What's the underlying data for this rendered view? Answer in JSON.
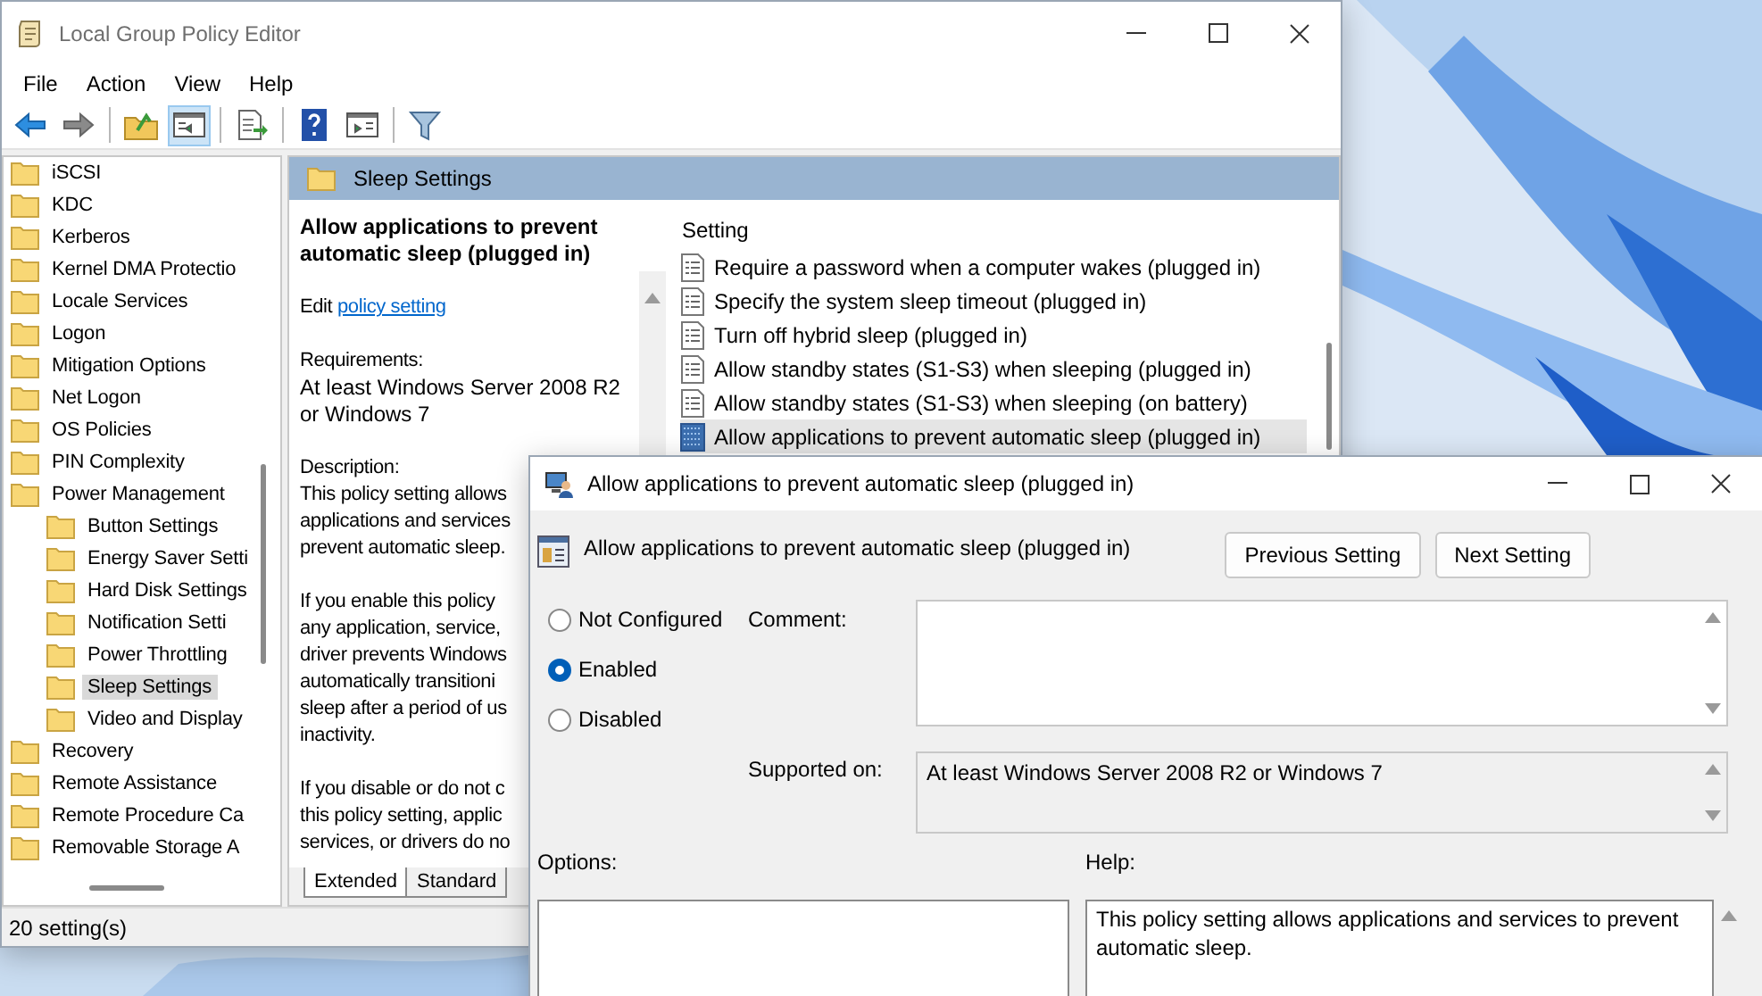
{
  "main_window": {
    "title": "Local Group Policy Editor",
    "menu": [
      "File",
      "Action",
      "View",
      "Help"
    ],
    "toolbar": [
      {
        "kind": "back",
        "pressed": false
      },
      {
        "kind": "forward",
        "pressed": false
      },
      {
        "kind": "separator"
      },
      {
        "kind": "up",
        "pressed": false
      },
      {
        "kind": "tree",
        "pressed": true
      },
      {
        "kind": "separator"
      },
      {
        "kind": "export",
        "pressed": false
      },
      {
        "kind": "separator"
      },
      {
        "kind": "help",
        "pressed": false
      },
      {
        "kind": "pane",
        "pressed": false
      },
      {
        "kind": "separator"
      },
      {
        "kind": "filter",
        "pressed": false
      }
    ],
    "tree": [
      {
        "label": "iSCSI",
        "selected": false
      },
      {
        "label": "KDC",
        "selected": false
      },
      {
        "label": "Kerberos",
        "selected": false
      },
      {
        "label": "Kernel DMA Protectio",
        "selected": false
      },
      {
        "label": "Locale Services",
        "selected": false
      },
      {
        "label": "Logon",
        "selected": false
      },
      {
        "label": "Mitigation Options",
        "selected": false
      },
      {
        "label": "Net Logon",
        "selected": false
      },
      {
        "label": "OS Policies",
        "selected": false
      },
      {
        "label": "PIN Complexity",
        "selected": false
      },
      {
        "label": "Power Management",
        "selected": false,
        "children": [
          {
            "label": "Button Settings",
            "selected": false
          },
          {
            "label": "Energy Saver Setti",
            "selected": false
          },
          {
            "label": "Hard Disk Settings",
            "selected": false
          },
          {
            "label": "Notification Setti",
            "selected": false
          },
          {
            "label": "Power Throttling",
            "selected": false
          },
          {
            "label": "Sleep Settings",
            "selected": true
          },
          {
            "label": "Video and Display",
            "selected": false
          }
        ]
      },
      {
        "label": "Recovery",
        "selected": false
      },
      {
        "label": "Remote Assistance",
        "selected": false
      },
      {
        "label": "Remote Procedure Ca",
        "selected": false
      },
      {
        "label": "Removable Storage A",
        "selected": false
      }
    ],
    "header": "Sleep Settings",
    "description": {
      "title": "Allow applications to prevent automatic sleep (plugged in)",
      "edit_prefix": "Edit",
      "edit_link": "policy setting",
      "requirements_label": "Requirements:",
      "requirements": "At least Windows Server 2008 R2 or Windows 7",
      "description_label": "Description:",
      "paragraphs": [
        [
          "This policy setting allows",
          "applications and services",
          "prevent automatic sleep."
        ],
        [
          "If you enable this policy",
          "any application, service,",
          "driver prevents Windows",
          "automatically transitioni",
          "sleep after a period of us",
          "inactivity."
        ],
        [
          "If you disable or do not c",
          "this policy setting, applic",
          "services, or drivers do no"
        ]
      ]
    },
    "list": {
      "column": "Setting",
      "rows": [
        {
          "label": "Require a password when a computer wakes (plugged in)",
          "selected": false
        },
        {
          "label": "Specify the system sleep timeout (plugged in)",
          "selected": false
        },
        {
          "label": "Turn off hybrid sleep (plugged in)",
          "selected": false
        },
        {
          "label": "Allow standby states (S1-S3) when sleeping (plugged in)",
          "selected": false
        },
        {
          "label": "Allow standby states (S1-S3) when sleeping (on battery)",
          "selected": false
        },
        {
          "label": "Allow applications to prevent automatic sleep (plugged in)",
          "selected": true
        }
      ]
    },
    "tabs": [
      {
        "label": "Extended",
        "selected": true
      },
      {
        "label": "Standard",
        "selected": false
      }
    ],
    "status_bar": "20 setting(s)"
  },
  "dialog": {
    "title": "Allow applications to prevent automatic sleep (plugged in)",
    "setting_name": "Allow applications to prevent automatic sleep (plugged in)",
    "buttons": [
      "Previous Setting",
      "Next Setting"
    ],
    "states": [
      {
        "label": "Not Configured",
        "selected": false
      },
      {
        "label": "Enabled",
        "selected": true
      },
      {
        "label": "Disabled",
        "selected": false
      }
    ],
    "comment_label": "Comment:",
    "supported_label": "Supported on:",
    "supported_on": "At least Windows Server 2008 R2 or Windows 7",
    "options_label": "Options:",
    "help_label": "Help:",
    "help_text": "This policy setting allows applications and services to prevent automatic sleep."
  }
}
